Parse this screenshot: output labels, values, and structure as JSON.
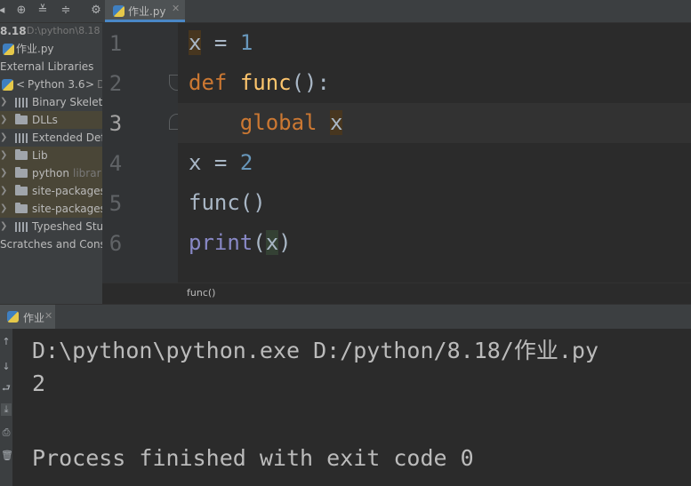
{
  "project_panel": {
    "toolbar_icons": [
      "collapse-arrow-icon",
      "locate-target-icon",
      "expand-all-icon",
      "collapse-all-icon",
      "gear-icon"
    ],
    "root": {
      "name": "8.18",
      "path": "D:\\python\\8.18"
    },
    "file": "作业.py",
    "external_libraries": "External Libraries",
    "sdk": {
      "prefix": "<",
      "label": "Python 3.6",
      "suffix": ">",
      "path_hint": "D"
    },
    "items": [
      {
        "label": "Binary Skeleto",
        "icon": "library-icon",
        "muted": ""
      },
      {
        "label": "DLLs",
        "icon": "folder-icon",
        "muted": ""
      },
      {
        "label": "Extended Def",
        "icon": "library-icon",
        "muted": ""
      },
      {
        "label": "Lib",
        "icon": "folder-icon",
        "muted": ""
      },
      {
        "label": "python",
        "icon": "folder-icon",
        "muted": "librar"
      },
      {
        "label": "site-packages",
        "icon": "folder-icon",
        "muted": ""
      },
      {
        "label": "site-packages",
        "icon": "folder-icon",
        "muted": ""
      },
      {
        "label": "Typeshed Stu",
        "icon": "library-icon",
        "muted": ""
      }
    ],
    "scratches": "Scratches and Cons"
  },
  "editor": {
    "tab_label": "作业.py",
    "line_numbers": [
      "1",
      "2",
      "3",
      "4",
      "5",
      "6"
    ],
    "current_line": "3",
    "code": [
      {
        "v1": "x",
        "op": " = ",
        "num": "1"
      },
      {
        "kw": "def",
        "fn": "func",
        "rest": "():"
      },
      {
        "indent": "    ",
        "kw": "global",
        "var": "x"
      },
      {
        "v1": "x",
        "op": " = ",
        "num": "2"
      },
      {
        "call": "func()"
      },
      {
        "builtin": "print",
        "open": "(",
        "arg": "x",
        "close": ")"
      }
    ],
    "breadcrumb": "func()"
  },
  "run": {
    "tab_label": "作业",
    "console_lines": [
      "D:\\python\\python.exe D:/python/8.18/作业.py",
      "2",
      "",
      "Process finished with exit code 0"
    ]
  },
  "colors": {
    "keyword": "#cc7832",
    "function": "#ffc66d",
    "number": "#6897bb",
    "builtin": "#8888c6",
    "text": "#a9b7c6"
  }
}
